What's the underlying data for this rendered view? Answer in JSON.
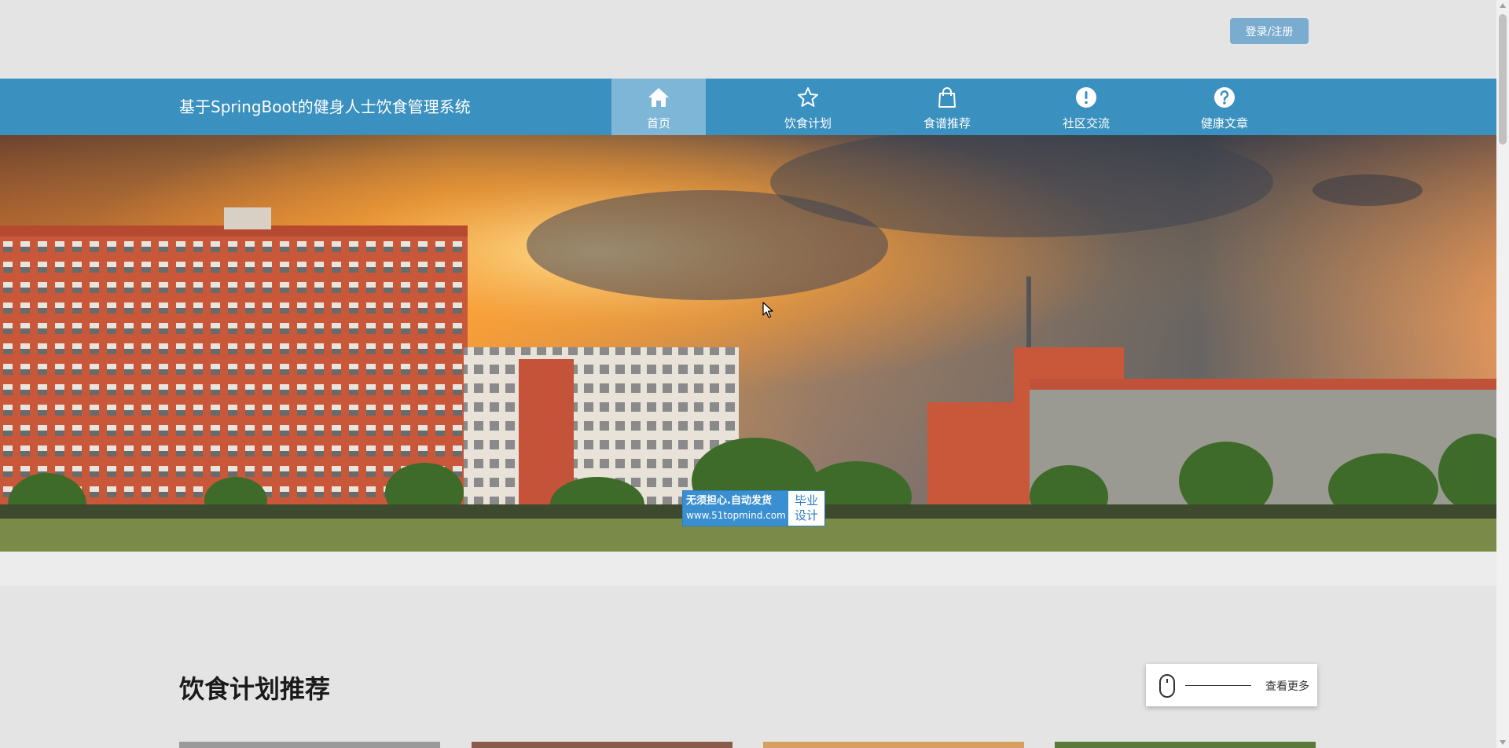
{
  "header": {
    "login_label": "登录/注册"
  },
  "nav": {
    "site_title": "基于SpringBoot的健身人士饮食管理系统",
    "items": [
      {
        "label": "首页",
        "icon": "home-icon",
        "active": true
      },
      {
        "label": "饮食计划",
        "icon": "star-icon",
        "active": false
      },
      {
        "label": "食谱推荐",
        "icon": "shopping-bag-icon",
        "active": false
      },
      {
        "label": "社区交流",
        "icon": "exclamation-circle-icon",
        "active": false
      },
      {
        "label": "健康文章",
        "icon": "question-circle-icon",
        "active": false
      }
    ]
  },
  "banner": {
    "badge_line1": "无须担心.自动发货",
    "badge_line2": "www.51topmind.com",
    "badge_right_line1": "毕业",
    "badge_right_line2": "设计",
    "active_slide": 2,
    "slide_count": 3
  },
  "section": {
    "title": "饮食计划推荐",
    "more_label": "查看更多"
  },
  "colors": {
    "nav_bg": "#3a90bf",
    "nav_active_bg": "#7eb6d8",
    "login_bg": "#7aacd0",
    "page_bg": "#e4e4e4"
  }
}
